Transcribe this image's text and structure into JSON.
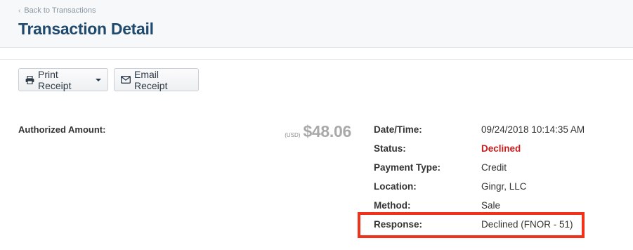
{
  "header": {
    "back_link": "Back to Transactions",
    "title": "Transaction Detail"
  },
  "toolbar": {
    "print_label": "Print Receipt",
    "email_label": "Email Receipt"
  },
  "summary": {
    "authorized_label": "Authorized Amount:",
    "currency": "(USD)",
    "amount": "$48.06"
  },
  "details": [
    {
      "label": "Date/Time:",
      "value": "09/24/2018 10:14:35 AM"
    },
    {
      "label": "Status:",
      "value": "Declined"
    },
    {
      "label": "Payment Type:",
      "value": "Credit"
    },
    {
      "label": "Location:",
      "value": "Gingr, LLC"
    },
    {
      "label": "Method:",
      "value": "Sale"
    },
    {
      "label": "Response:",
      "value": "Declined (FNOR - 51)"
    }
  ],
  "colors": {
    "title": "#1f4a6d",
    "declined": "#c81d1d",
    "highlight": "#f0321a"
  }
}
